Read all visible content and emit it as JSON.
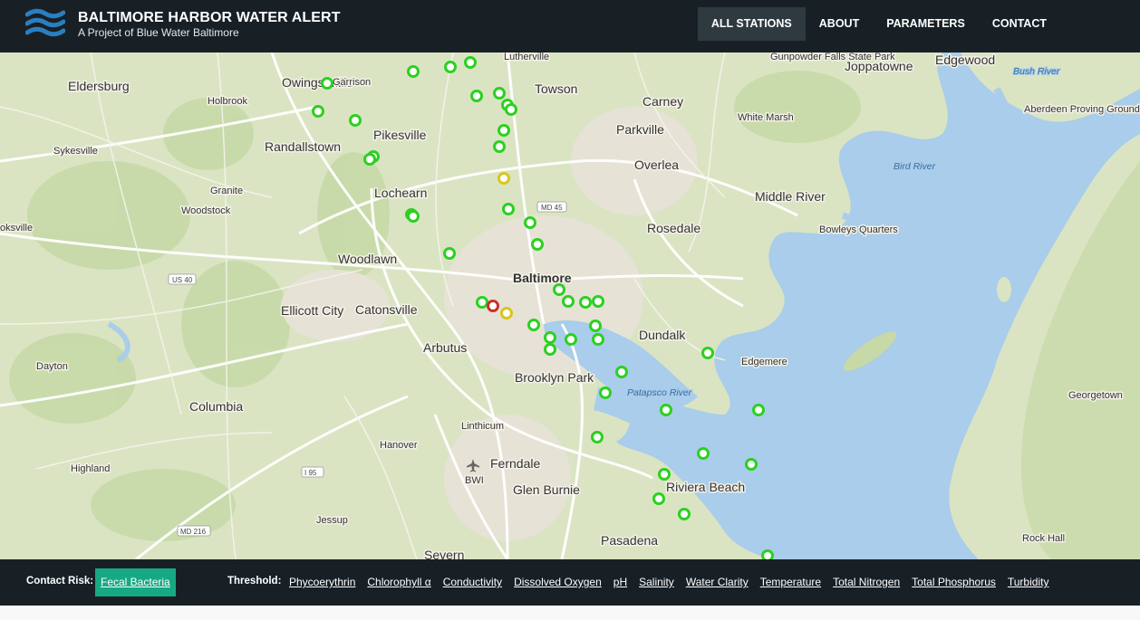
{
  "header": {
    "title": "BALTIMORE HARBOR WATER ALERT",
    "subtitle": "A Project of Blue Water Baltimore",
    "nav": [
      "ALL STATIONS",
      "ABOUT",
      "PARAMETERS",
      "CONTACT"
    ],
    "active_nav": "ALL STATIONS"
  },
  "map": {
    "labels": {
      "lutherville": "Lutherville",
      "gunpowder": "Gunpowder Falls State Park",
      "joppatowne": "Joppatowne",
      "edgewood": "Edgewood",
      "bush_river": "Bush River",
      "aberdeen": "Aberdeen Proving Ground",
      "eldersburg": "Eldersburg",
      "owings_mills": "Owings Mills",
      "garrison": "Garrison",
      "holbrook": "Holbrook",
      "towson": "Towson",
      "carney": "Carney",
      "white_marsh": "White Marsh",
      "sykesville": "Sykesville",
      "randallstown": "Randallstown",
      "pikesville": "Pikesville",
      "parkville": "Parkville",
      "overlea": "Overlea",
      "bird_river": "Bird River",
      "granite": "Granite",
      "woodstock": "Woodstock",
      "lochearn": "Lochearn",
      "middle_river": "Middle River",
      "bowleys": "Bowleys Quarters",
      "rosedale": "Rosedale",
      "eldersville_cut": "oksville",
      "woodlawn": "Woodlawn",
      "baltimore": "Baltimore",
      "ellicott_city": "Ellicott City",
      "catonsville": "Catonsville",
      "arbutus": "Arbutus",
      "dundalk": "Dundalk",
      "edgemere": "Edgemere",
      "dayton": "Dayton",
      "brooklyn_park": "Brooklyn Park",
      "patapsco": "Patapsco River",
      "georgetown": "Georgetown",
      "columbia": "Columbia",
      "linthicum": "Linthicum",
      "hanover": "Hanover",
      "ferndale": "Ferndale",
      "bwi": "BWI",
      "highland": "Highland",
      "glen_burnie": "Glen Burnie",
      "riviera_beach": "Riviera Beach",
      "jessup": "Jessup",
      "pasadena": "Pasadena",
      "rock_hall": "Rock Hall",
      "severn": "Severn"
    },
    "shields": {
      "md45": "MD 45",
      "us40": "US 40",
      "i95": "I 95",
      "md216": "MD 216"
    },
    "station_counts": {
      "good": 49,
      "caution": 2,
      "alert": 1
    },
    "colors": {
      "good": "#2bd11f",
      "caution": "#d7c61c",
      "alert": "#c9302c",
      "water": "#a9cdea",
      "land": "#d9e5c1"
    }
  },
  "footer": {
    "contact_risk_label": "Contact Risk:",
    "contact_risk_value": "Fecal Bacteria",
    "threshold_label": "Threshold:",
    "parameters": [
      "Phycoerythrin",
      "Chlorophyll α",
      "Conductivity",
      "Dissolved Oxygen",
      "pH",
      "Salinity",
      "Water Clarity",
      "Temperature",
      "Total Nitrogen",
      "Total Phosphorus",
      "Turbidity"
    ]
  }
}
